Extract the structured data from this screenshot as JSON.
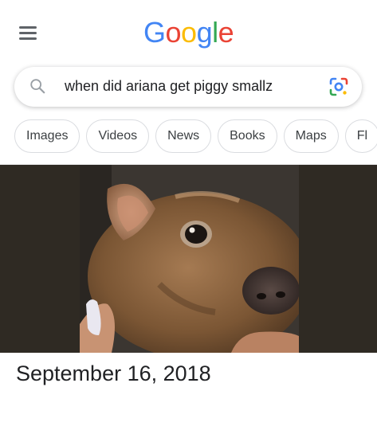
{
  "header": {
    "logo_letters": [
      "G",
      "o",
      "o",
      "g",
      "l",
      "e"
    ],
    "logo_colors": [
      "#4285F4",
      "#EA4335",
      "#FBBC05",
      "#4285F4",
      "#34A853",
      "#EA4335"
    ],
    "menu_icon": "hamburger-menu-icon"
  },
  "search": {
    "query": "when did ariana get piggy smallz",
    "search_icon": "magnifier-icon",
    "lens_icon": "google-lens-icon"
  },
  "tabs": [
    "Images",
    "Videos",
    "News",
    "Books",
    "Maps",
    "Fl"
  ],
  "result": {
    "image_subject": "piglet",
    "date": "September 16, 2018"
  }
}
